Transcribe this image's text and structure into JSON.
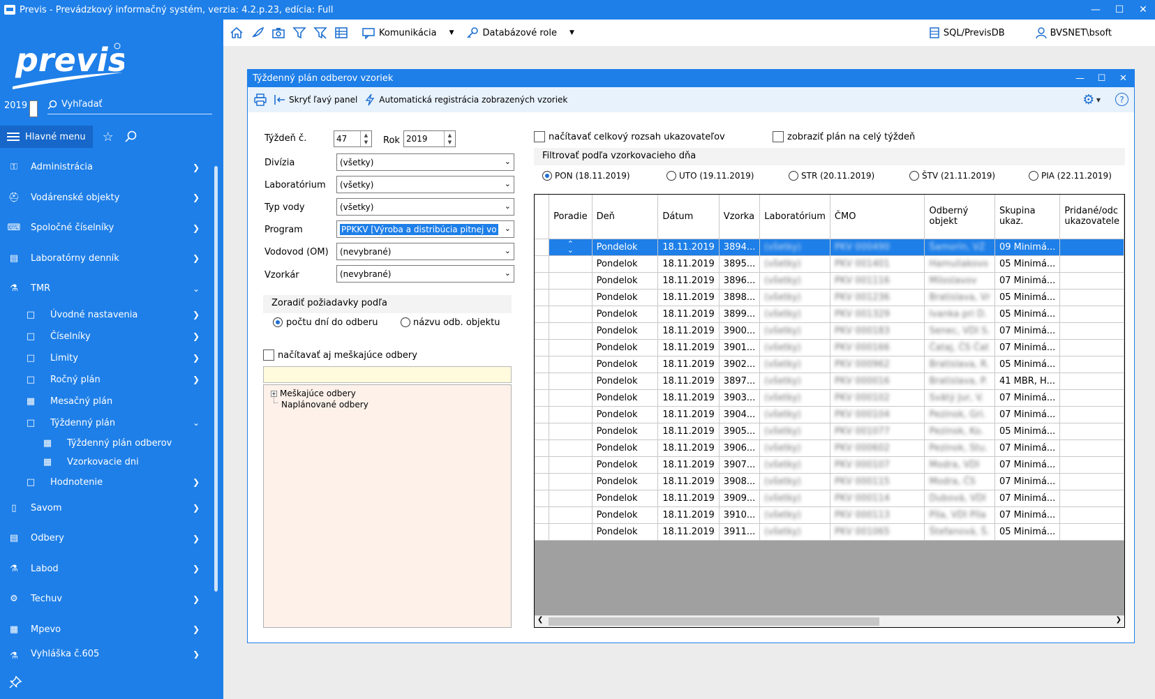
{
  "window": {
    "title": "Previs - Prevádzkový informačný systém, verzia: 4.2.p.23, edícia: Full"
  },
  "sidebar": {
    "logo": "previs",
    "year": "2019",
    "search_label": "Vyhľadať",
    "main_menu_label": "Hlavné menu",
    "items": [
      {
        "label": "Administrácia"
      },
      {
        "label": "Vodárenské objekty"
      },
      {
        "label": "Spoločné číselníky"
      },
      {
        "label": "Laboratórny denník"
      },
      {
        "label": "TMR"
      },
      {
        "label": "Úvodné nastavenia"
      },
      {
        "label": "Číselníky"
      },
      {
        "label": "Limity"
      },
      {
        "label": "Ročný plán"
      },
      {
        "label": "Mesačný plán"
      },
      {
        "label": "Týždenný plán"
      },
      {
        "label": "Týždenný plán odberov"
      },
      {
        "label": "Vzorkovacie dni"
      },
      {
        "label": "Hodnotenie"
      },
      {
        "label": "Savom"
      },
      {
        "label": "Odbery"
      },
      {
        "label": "Labod"
      },
      {
        "label": "Techuv"
      },
      {
        "label": "Mpevo"
      },
      {
        "label": "Vyhláška č.605"
      }
    ]
  },
  "toolbar": {
    "komunikacia": "Komunikácia",
    "databazove_role": "Databázové role",
    "db": "SQL/PrevisDB",
    "user": "BVSNET\\bsoft"
  },
  "dialog": {
    "title": "Týždenný plán odberov vzoriek",
    "hide_panel": "Skryť ľavý panel",
    "auto_reg": "Automatická registrácia zobrazených vzoriek",
    "tyzden_label": "Týždeň č.",
    "tyzden_value": "47",
    "rok_label": "Rok",
    "rok_value": "2019",
    "divizia_label": "Divízia",
    "divizia_value": "(všetky)",
    "laboratorium_label": "Laboratórium",
    "laboratorium_value": "(všetky)",
    "typ_vody_label": "Typ vody",
    "typ_vody_value": "(všetky)",
    "program_label": "Program",
    "program_value": "PPKKV [Výroba a distribúcia pitnej vo",
    "vodovod_label": "Vodovod (OM)",
    "vodovod_value": "(nevybrané)",
    "vzorkar_label": "Vzorkár",
    "vzorkar_value": "(nevybrané)",
    "zoradit_title": "Zoradiť požiadavky podľa",
    "zoradit_opt1": "počtu dní do odberu",
    "zoradit_opt2": "názvu odb. objektu",
    "meskajuce_chk": "načítavať aj meškajúce odbery",
    "tree_item1": "Meškajúce odbery",
    "tree_item2": "Naplánované odbery",
    "rozsah_chk": "načítavať celkový rozsah ukazovateľov",
    "cely_tyzden_chk": "zobraziť plán na celý týždeň",
    "filter_title": "Filtrovať podľa vzorkovacieho dňa",
    "days": [
      "PON (18.11.2019)",
      "UTO (19.11.2019)",
      "STR (20.11.2019)",
      "ŠTV (21.11.2019)",
      "PIA (22.11.2019)"
    ]
  },
  "grid": {
    "headers": [
      "Poradie",
      "Deň",
      "Dátum",
      "Vzorka",
      "Laboratórium",
      "ČMO",
      "Odberný objekt",
      "Skupina ukaz.",
      "Pridané/odc ukazovatele"
    ],
    "rows": [
      {
        "den": "Pondelok",
        "datum": "18.11.2019",
        "vzorka": "3894...",
        "lab": "(všetky)",
        "cmo": "PKV 000490",
        "objekt": "Šamorín, VZ",
        "skupina": "09 Minimá..."
      },
      {
        "den": "Pondelok",
        "datum": "18.11.2019",
        "vzorka": "3895...",
        "lab": "(všetky)",
        "cmo": "PKV 001401",
        "objekt": "Hamuliakovo",
        "skupina": "05 Minimá..."
      },
      {
        "den": "Pondelok",
        "datum": "18.11.2019",
        "vzorka": "3896...",
        "lab": "(všetky)",
        "cmo": "PKV 001116",
        "objekt": "Miloslavov",
        "skupina": "07 Minimá..."
      },
      {
        "den": "Pondelok",
        "datum": "18.11.2019",
        "vzorka": "3898...",
        "lab": "(všetky)",
        "cmo": "PKV 001236",
        "objekt": "Bratislava, Vr",
        "skupina": "05 Minimá..."
      },
      {
        "den": "Pondelok",
        "datum": "18.11.2019",
        "vzorka": "3899...",
        "lab": "(všetky)",
        "cmo": "PKV 001329",
        "objekt": "Ivanka pri D.",
        "skupina": "05 Minimá..."
      },
      {
        "den": "Pondelok",
        "datum": "18.11.2019",
        "vzorka": "3900...",
        "lab": "(všetky)",
        "cmo": "PKV 000183",
        "objekt": "Senec, VDI S.",
        "skupina": "07 Minimá..."
      },
      {
        "den": "Pondelok",
        "datum": "18.11.2019",
        "vzorka": "3901...",
        "lab": "(všetky)",
        "cmo": "PKV 000166",
        "objekt": "Čataj, ČS Čat",
        "skupina": "07 Minimá..."
      },
      {
        "den": "Pondelok",
        "datum": "18.11.2019",
        "vzorka": "3902...",
        "lab": "(všetky)",
        "cmo": "PKV 000962",
        "objekt": "Bratislava, R.",
        "skupina": "05 Minimá..."
      },
      {
        "den": "Pondelok",
        "datum": "18.11.2019",
        "vzorka": "3897...",
        "lab": "(všetky)",
        "cmo": "PKV 000016",
        "objekt": "Bratislava, P.",
        "skupina": "41 MBR, H..."
      },
      {
        "den": "Pondelok",
        "datum": "18.11.2019",
        "vzorka": "3903...",
        "lab": "(všetky)",
        "cmo": "PKV 000102",
        "objekt": "Svätý Jur, V.",
        "skupina": "07 Minimá..."
      },
      {
        "den": "Pondelok",
        "datum": "18.11.2019",
        "vzorka": "3904...",
        "lab": "(všetky)",
        "cmo": "PKV 000104",
        "objekt": "Pezinok, Gri.",
        "skupina": "07 Minimá..."
      },
      {
        "den": "Pondelok",
        "datum": "18.11.2019",
        "vzorka": "3905...",
        "lab": "(všetky)",
        "cmo": "PKV 001077",
        "objekt": "Pezinok, Ko.",
        "skupina": "05 Minimá..."
      },
      {
        "den": "Pondelok",
        "datum": "18.11.2019",
        "vzorka": "3906...",
        "lab": "(všetky)",
        "cmo": "PKV 000602",
        "objekt": "Pezinok, Stu.",
        "skupina": "07 Minimá..."
      },
      {
        "den": "Pondelok",
        "datum": "18.11.2019",
        "vzorka": "3907...",
        "lab": "(všetky)",
        "cmo": "PKV 000107",
        "objekt": "Modra, VDI",
        "skupina": "07 Minimá..."
      },
      {
        "den": "Pondelok",
        "datum": "18.11.2019",
        "vzorka": "3908...",
        "lab": "(všetky)",
        "cmo": "PKV 000115",
        "objekt": "Modra, ČS",
        "skupina": "07 Minimá..."
      },
      {
        "den": "Pondelok",
        "datum": "18.11.2019",
        "vzorka": "3909...",
        "lab": "(všetky)",
        "cmo": "PKV 000114",
        "objekt": "Dubová, VDI",
        "skupina": "07 Minimá..."
      },
      {
        "den": "Pondelok",
        "datum": "18.11.2019",
        "vzorka": "3910...",
        "lab": "(všetky)",
        "cmo": "PKV 000113",
        "objekt": "Píla, VDI Píla",
        "skupina": "07 Minimá..."
      },
      {
        "den": "Pondelok",
        "datum": "18.11.2019",
        "vzorka": "3911...",
        "lab": "(všetky)",
        "cmo": "PKV 001065",
        "objekt": "Štefanová, Š.",
        "skupina": "05 Minimá..."
      }
    ]
  },
  "colors": {
    "accent": "#1e7fe8"
  }
}
